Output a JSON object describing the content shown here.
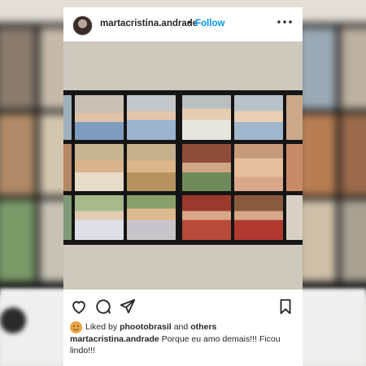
{
  "post": {
    "username": "martacristina.andrade",
    "separator": "•",
    "follow_label": "Follow",
    "more_label": "•••",
    "likes_prefix": "Liked by",
    "liked_by_user": "phootobrasil",
    "likes_and": "and",
    "likes_others": "others",
    "caption_user": "martacristina.andrade",
    "caption_text": "Porque eu amo demais!!! Ficou lindo!!!"
  },
  "icons": {
    "more": "more-options-icon",
    "like": "heart-icon",
    "comment": "comment-icon",
    "share": "send-icon",
    "save": "bookmark-icon",
    "tagged": "tagged-user-icon"
  },
  "colors": {
    "follow": "#0095f6",
    "text": "#262626"
  }
}
